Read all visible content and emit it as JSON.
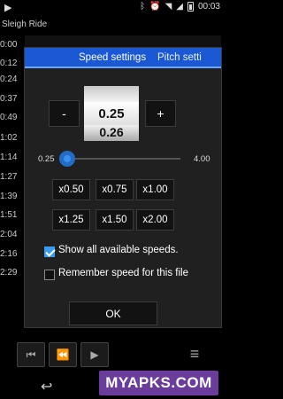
{
  "status_bar": {
    "time": "00:03"
  },
  "song_title": "Sleigh Ride",
  "times": [
    "0:00",
    "0:12",
    "0:24",
    "0:37",
    "0:49",
    "1:02",
    "1:14",
    "1:27",
    "1:39",
    "1:51",
    "2:04",
    "2:16",
    "2:29"
  ],
  "dialog": {
    "tabs": [
      "Speed settings",
      "Pitch setti"
    ],
    "minus_label": "-",
    "plus_label": "+",
    "drum": {
      "prev": "",
      "current": "0.25",
      "next": "0.26"
    },
    "slider": {
      "min_label": "0.25",
      "max_label": "4.00",
      "value": 0.25,
      "min": 0.25,
      "max": 4.0
    },
    "speed_buttons": [
      "x0.50",
      "x0.75",
      "x1.00",
      "x1.25",
      "x1.50",
      "x2.00"
    ],
    "show_all_label": "Show all available speeds.",
    "show_all_checked": true,
    "remember_label": "Remember speed for this file",
    "remember_checked": false,
    "ok_label": "OK"
  },
  "watermark": "MYAPKS.COM",
  "colors": {
    "tab_blue": "#1a58d4",
    "accent": "#3a9cf0",
    "watermark": "#6a3c9c"
  }
}
